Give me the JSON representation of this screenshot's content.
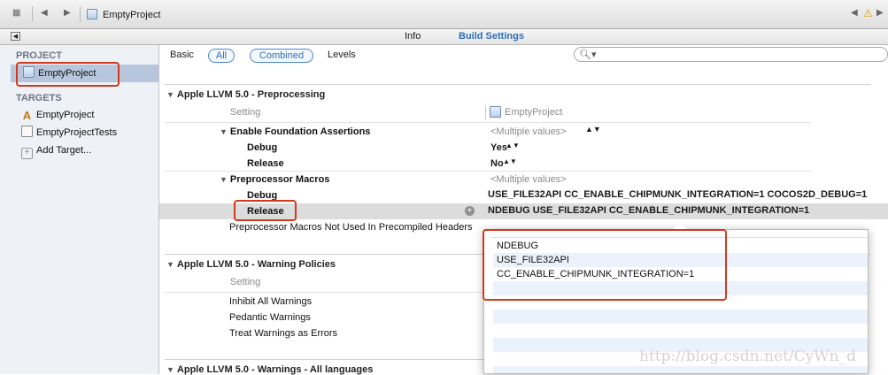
{
  "jumpbar": {
    "breadcrumb": "EmptyProject"
  },
  "editor_tabs": {
    "info": "Info",
    "build_settings": "Build Settings"
  },
  "sidebar": {
    "project_header": "PROJECT",
    "project_item": "EmptyProject",
    "targets_header": "TARGETS",
    "targets": [
      "EmptyProject",
      "EmptyProjectTests"
    ],
    "add_target": "Add Target..."
  },
  "filter": {
    "basic": "Basic",
    "all": "All",
    "combined": "Combined",
    "levels": "Levels",
    "search_placeholder": ""
  },
  "preprocessing": {
    "title": "Apple LLVM 5.0 - Preprocessing",
    "setting_col": "Setting",
    "project_col": "EmptyProject",
    "assertions": {
      "label": "Enable Foundation Assertions",
      "value": "<Multiple values>",
      "debug_label": "Debug",
      "debug_value": "Yes",
      "release_label": "Release",
      "release_value": "No"
    },
    "macros": {
      "label": "Preprocessor Macros",
      "value": "<Multiple values>",
      "debug_label": "Debug",
      "debug_value": "USE_FILE32API CC_ENABLE_CHIPMUNK_INTEGRATION=1 COCOS2D_DEBUG=1",
      "release_label": "Release",
      "release_value": "NDEBUG USE_FILE32API CC_ENABLE_CHIPMUNK_INTEGRATION=1"
    },
    "not_used": "Preprocessor Macros Not Used In Precompiled Headers"
  },
  "warning_policies": {
    "title": "Apple LLVM 5.0 - Warning Policies",
    "setting_col": "Setting",
    "rows": [
      "Inhibit All Warnings",
      "Pedantic Warnings",
      "Treat Warnings as Errors"
    ]
  },
  "warnings_all": {
    "title": "Apple LLVM 5.0 - Warnings - All languages"
  },
  "popup": {
    "entries": [
      "NDEBUG",
      "USE_FILE32API",
      "CC_ENABLE_CHIPMUNK_INTEGRATION=1"
    ]
  },
  "watermark": "http://blog.csdn.net/CyWn_d",
  "colors": {
    "accent": "#2f6fb4",
    "highlight_box": "#d23a1e",
    "selected_row": "#dcdcdc",
    "sidebar_selection": "#b7c6dc"
  }
}
